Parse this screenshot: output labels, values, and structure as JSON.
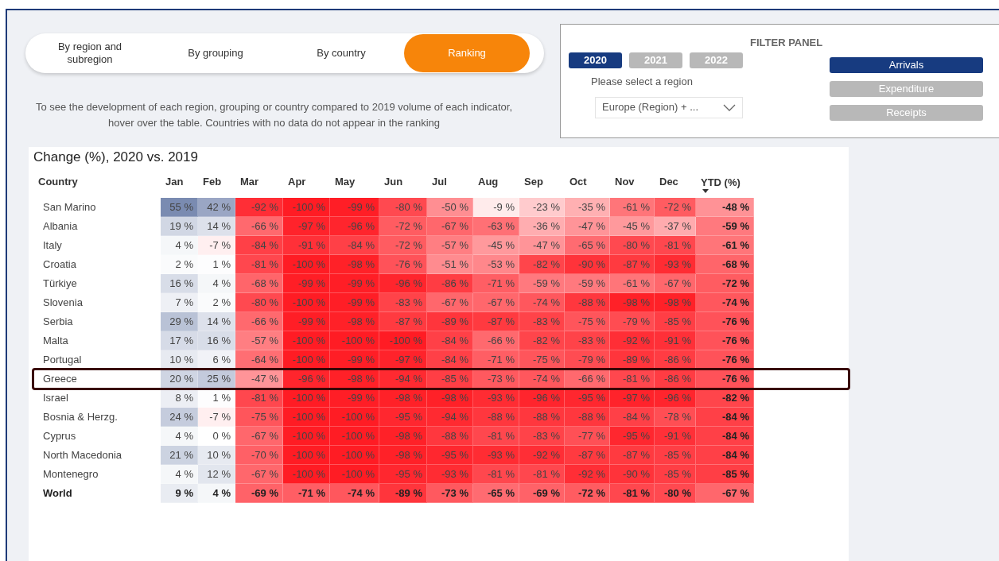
{
  "tabs": [
    {
      "label": "By region and subregion",
      "selected": false
    },
    {
      "label": "By grouping",
      "selected": false
    },
    {
      "label": "By country",
      "selected": false
    },
    {
      "label": "Ranking",
      "selected": true
    }
  ],
  "description": "To see the development of each region, grouping or country compared to 2019 volume of each indicator, hover over the table. Countries with no data do not appear in the ranking",
  "filter_panel": {
    "title": "FILTER PANEL",
    "years": [
      {
        "label": "2020",
        "selected": true
      },
      {
        "label": "2021",
        "selected": false
      },
      {
        "label": "2022",
        "selected": false
      }
    ],
    "region_label": "Please select a region",
    "region_select": {
      "value": "Europe (Region) + ..."
    },
    "indicators": [
      {
        "label": "Arrivals",
        "selected": true
      },
      {
        "label": "Expenditure",
        "selected": false
      },
      {
        "label": "Receipts",
        "selected": false
      }
    ]
  },
  "table": {
    "title": "Change (%), 2020 vs. 2019",
    "columns": [
      {
        "label": "Country",
        "sorted": false
      },
      {
        "label": "Jan",
        "sorted": false
      },
      {
        "label": "Feb",
        "sorted": false
      },
      {
        "label": "Mar",
        "sorted": false
      },
      {
        "label": "Apr",
        "sorted": false
      },
      {
        "label": "May",
        "sorted": false
      },
      {
        "label": "Jun",
        "sorted": false
      },
      {
        "label": "Jul",
        "sorted": false
      },
      {
        "label": "Aug",
        "sorted": false
      },
      {
        "label": "Sep",
        "sorted": false
      },
      {
        "label": "Oct",
        "sorted": false
      },
      {
        "label": "Nov",
        "sorted": false
      },
      {
        "label": "Dec",
        "sorted": false
      },
      {
        "label": "YTD (%)",
        "sorted": true
      }
    ],
    "rows": [
      {
        "kind": "country",
        "selected": false,
        "cells": [
          "San Marino",
          "55 %",
          "42 %",
          "-92 %",
          "-100 %",
          "-99 %",
          "-80 %",
          "-50 %",
          "-9 %",
          "-23 %",
          "-35 %",
          "-61 %",
          "-72 %",
          "-48 %"
        ]
      },
      {
        "kind": "country",
        "selected": false,
        "cells": [
          "Albania",
          "19 %",
          "14 %",
          "-66 %",
          "-97 %",
          "-96 %",
          "-72 %",
          "-67 %",
          "-63 %",
          "-36 %",
          "-47 %",
          "-45 %",
          "-37 %",
          "-59 %"
        ]
      },
      {
        "kind": "country",
        "selected": false,
        "cells": [
          "Italy",
          "4 %",
          "-7 %",
          "-84 %",
          "-91 %",
          "-84 %",
          "-72 %",
          "-57 %",
          "-45 %",
          "-47 %",
          "-65 %",
          "-80 %",
          "-81 %",
          "-61 %"
        ]
      },
      {
        "kind": "country",
        "selected": false,
        "cells": [
          "Croatia",
          "2 %",
          "1 %",
          "-81 %",
          "-100 %",
          "-98 %",
          "-76 %",
          "-51 %",
          "-53 %",
          "-82 %",
          "-90 %",
          "-87 %",
          "-93 %",
          "-68 %"
        ]
      },
      {
        "kind": "country",
        "selected": false,
        "cells": [
          "Türkiye",
          "16 %",
          "4 %",
          "-68 %",
          "-99 %",
          "-99 %",
          "-96 %",
          "-86 %",
          "-71 %",
          "-59 %",
          "-59 %",
          "-61 %",
          "-67 %",
          "-72 %"
        ]
      },
      {
        "kind": "country",
        "selected": false,
        "cells": [
          "Slovenia",
          "7 %",
          "2 %",
          "-80 %",
          "-100 %",
          "-99 %",
          "-83 %",
          "-67 %",
          "-67 %",
          "-74 %",
          "-88 %",
          "-98 %",
          "-98 %",
          "-74 %"
        ]
      },
      {
        "kind": "country",
        "selected": false,
        "cells": [
          "Serbia",
          "29 %",
          "14 %",
          "-66 %",
          "-99 %",
          "-98 %",
          "-87 %",
          "-89 %",
          "-87 %",
          "-83 %",
          "-75 %",
          "-79 %",
          "-85 %",
          "-76 %"
        ]
      },
      {
        "kind": "country",
        "selected": false,
        "cells": [
          "Malta",
          "17 %",
          "16 %",
          "-57 %",
          "-100 %",
          "-100 %",
          "-100 %",
          "-84 %",
          "-66 %",
          "-82 %",
          "-83 %",
          "-92 %",
          "-91 %",
          "-76 %"
        ]
      },
      {
        "kind": "country",
        "selected": false,
        "cells": [
          "Portugal",
          "10 %",
          "6 %",
          "-64 %",
          "-100 %",
          "-99 %",
          "-97 %",
          "-84 %",
          "-71 %",
          "-75 %",
          "-79 %",
          "-89 %",
          "-86 %",
          "-76 %"
        ]
      },
      {
        "kind": "country",
        "selected": true,
        "cells": [
          "Greece",
          "20 %",
          "25 %",
          "-47 %",
          "-96 %",
          "-98 %",
          "-94 %",
          "-85 %",
          "-73 %",
          "-74 %",
          "-66 %",
          "-81 %",
          "-86 %",
          "-76 %"
        ]
      },
      {
        "kind": "country",
        "selected": false,
        "cells": [
          "Israel",
          "8 %",
          "1 %",
          "-81 %",
          "-100 %",
          "-99 %",
          "-98 %",
          "-98 %",
          "-93 %",
          "-96 %",
          "-95 %",
          "-97 %",
          "-96 %",
          "-82 %"
        ]
      },
      {
        "kind": "country",
        "selected": false,
        "cells": [
          "Bosnia & Herzg.",
          "24 %",
          "-7 %",
          "-75 %",
          "-100 %",
          "-100 %",
          "-95 %",
          "-94 %",
          "-88 %",
          "-88 %",
          "-88 %",
          "-84 %",
          "-78 %",
          "-84 %"
        ]
      },
      {
        "kind": "country",
        "selected": false,
        "cells": [
          "Cyprus",
          "4 %",
          "0 %",
          "-67 %",
          "-100 %",
          "-100 %",
          "-98 %",
          "-88 %",
          "-81 %",
          "-83 %",
          "-77 %",
          "-95 %",
          "-91 %",
          "-84 %"
        ]
      },
      {
        "kind": "country",
        "selected": false,
        "cells": [
          "North Macedonia",
          "21 %",
          "10 %",
          "-70 %",
          "-100 %",
          "-100 %",
          "-98 %",
          "-95 %",
          "-93 %",
          "-92 %",
          "-87 %",
          "-87 %",
          "-85 %",
          "-84 %"
        ]
      },
      {
        "kind": "country",
        "selected": false,
        "cells": [
          "Montenegro",
          "4 %",
          "12 %",
          "-67 %",
          "-100 %",
          "-100 %",
          "-95 %",
          "-93 %",
          "-81 %",
          "-81 %",
          "-92 %",
          "-90 %",
          "-85 %",
          "-85 %"
        ]
      },
      {
        "kind": "total",
        "selected": false,
        "cells": [
          "World",
          "9 %",
          "4 %",
          "-69 %",
          "-71 %",
          "-74 %",
          "-89 %",
          "-73 %",
          "-65 %",
          "-69 %",
          "-72 %",
          "-81 %",
          "-80 %",
          "-67 %"
        ]
      }
    ]
  }
}
